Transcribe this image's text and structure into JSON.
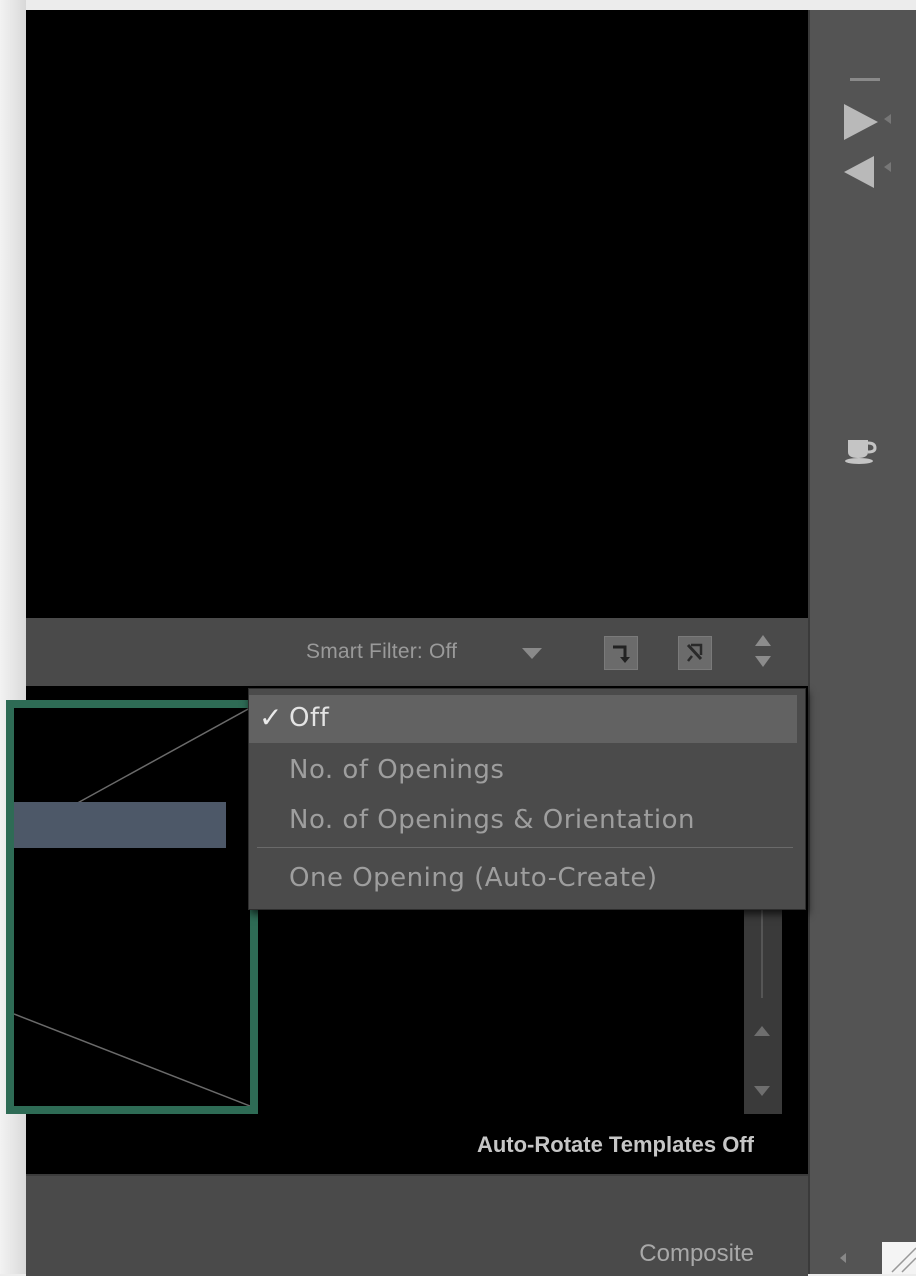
{
  "smart_filter": {
    "label": "Smart Filter: Off"
  },
  "filter_menu": {
    "check_mark": "✓",
    "items": [
      {
        "label": "Off",
        "selected": true
      },
      {
        "label": "No. of Openings",
        "selected": false
      },
      {
        "label": "No. of Openings & Orientation",
        "selected": false
      },
      {
        "label": "One Opening (Auto-Create)",
        "selected": false
      }
    ]
  },
  "status": {
    "auto_rotate": "Auto-Rotate Templates Off"
  },
  "bottom_bar": {
    "view_mode": "Composite"
  },
  "colors": {
    "template_border": "#2e6b55",
    "selection": "#626262"
  }
}
